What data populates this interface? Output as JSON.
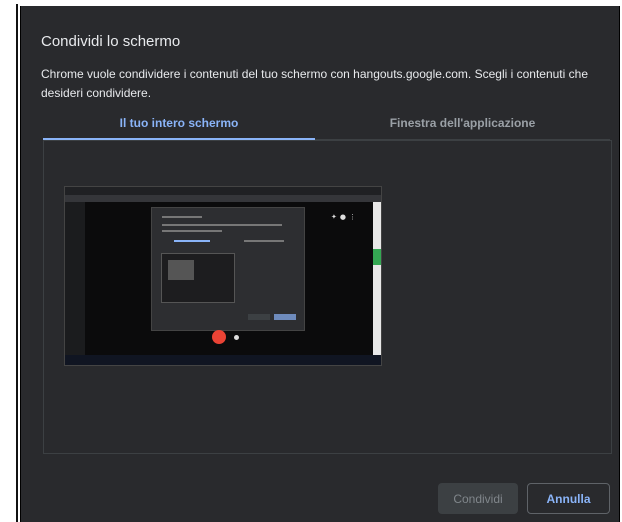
{
  "window_title_fragment": "",
  "dialog": {
    "title": "Condividi lo schermo",
    "description": "Chrome vuole condividere i contenuti del tuo schermo con hangouts.google.com. Scegli i contenuti che desideri condividere."
  },
  "tabs": [
    {
      "label": "Il tuo intero schermo",
      "active": true
    },
    {
      "label": "Finestra dell'applicazione",
      "active": false
    }
  ],
  "buttons": {
    "share_label": "Condividi",
    "cancel_label": "Annulla"
  },
  "colors": {
    "dialog_bg": "#292a2d",
    "accent": "#8ab4f8",
    "text": "#e8eaed",
    "muted": "#9aa0a6"
  }
}
